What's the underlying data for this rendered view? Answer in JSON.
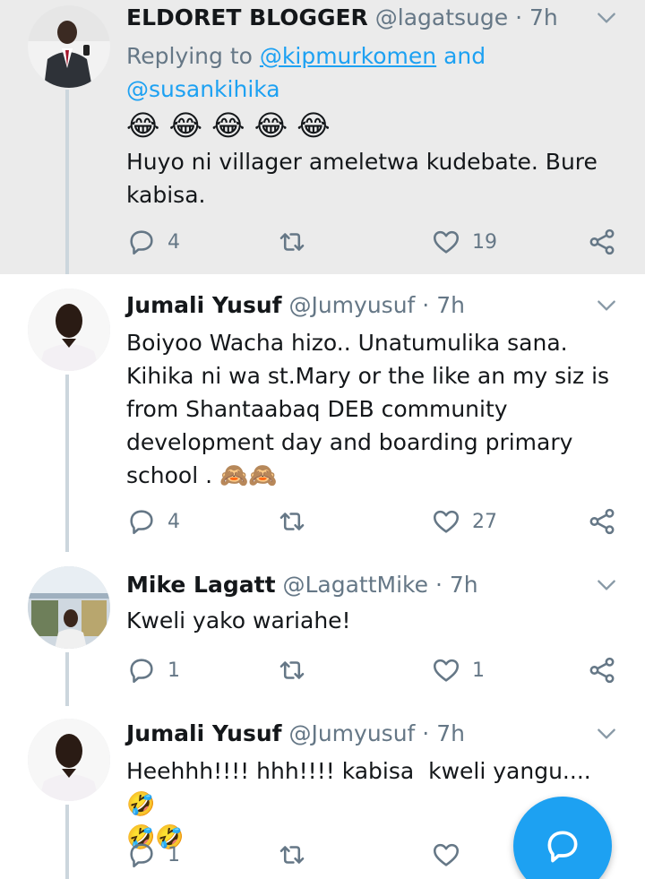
{
  "colors": {
    "accent": "#1da1f2",
    "secondary_text": "#657786",
    "highlight_bg": "#ebebeb",
    "thread_line": "#ccd6dd"
  },
  "tweets": [
    {
      "name": "ELDORET BLOGGER",
      "handle": "@lagatsuge",
      "time": "· 7h",
      "replying_label": "Replying to",
      "mention_1": "@kipmurkomen",
      "and_label": "and",
      "mention_2": "@susankihika",
      "emoji_line": "😂 😂 😂 😂 😂",
      "text": "Huyo ni villager ameletwa kudebate. Bure kabisa.",
      "reply_count": "4",
      "retweet_count": "",
      "like_count": "19"
    },
    {
      "name": "Jumali Yusuf",
      "handle": "@Jumyusuf",
      "time": "· 7h",
      "text": "Boiyoo Wacha hizo.. Unatumulika sana. Kihika ni wa st.Mary or the like an my siz is from Shantaabaq DEB community development day and boarding primary school .",
      "text_emoji": "🙈🙈",
      "reply_count": "4",
      "retweet_count": "",
      "like_count": "27"
    },
    {
      "name": "Mike Lagatt",
      "handle": "@LagattMike",
      "time": "· 7h",
      "text": "Kweli yako wariahe!",
      "reply_count": "1",
      "retweet_count": "",
      "like_count": "1"
    },
    {
      "name": "Jumali Yusuf",
      "handle": "@Jumyusuf",
      "time": "· 7h",
      "text": "Heehhh!!!! hhh!!!! kabisa  kweli yangu....",
      "text_emoji": "🤣",
      "emoji_line": "🤣🤣",
      "reply_count": "1",
      "retweet_count": "",
      "like_count": ""
    }
  ],
  "icons": {
    "reply": "reply-icon",
    "retweet": "retweet-icon",
    "like": "heart-icon",
    "share": "share-icon",
    "chevron": "chevron-down-icon",
    "compose": "compose-reply-icon"
  }
}
